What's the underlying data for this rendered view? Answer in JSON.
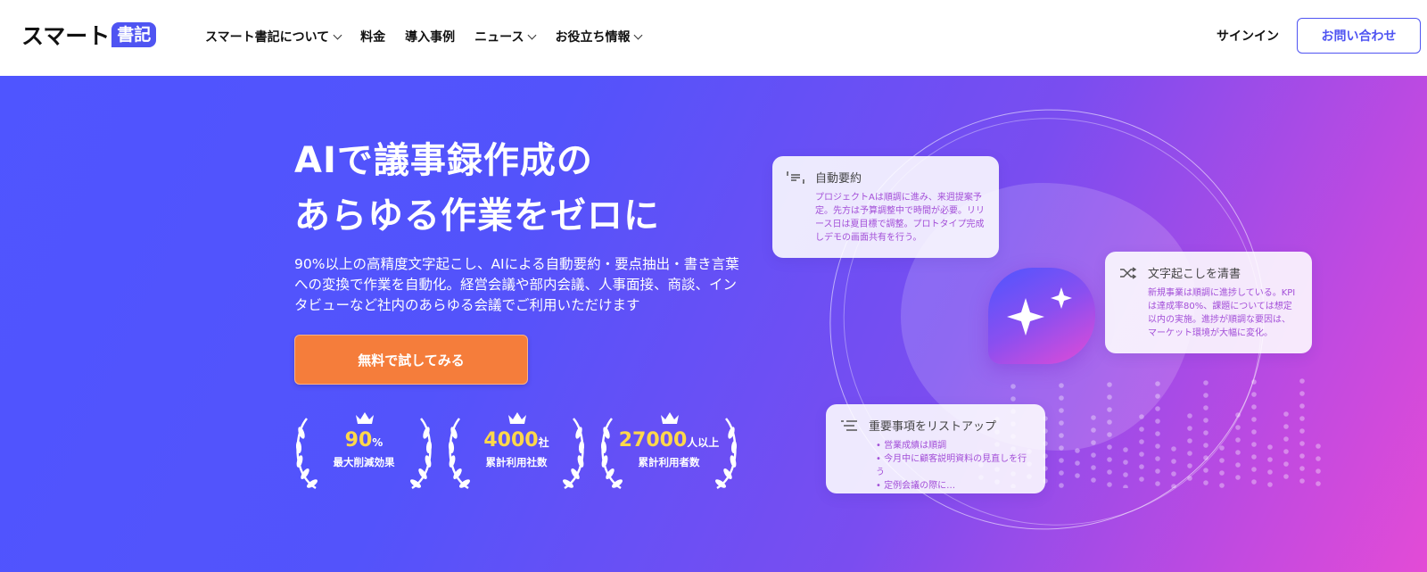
{
  "header": {
    "logo_text": "スマート",
    "logo_badge": "書記",
    "nav": [
      {
        "label": "スマート書記について",
        "has_dropdown": true
      },
      {
        "label": "料金",
        "has_dropdown": false
      },
      {
        "label": "導入事例",
        "has_dropdown": false
      },
      {
        "label": "ニュース",
        "has_dropdown": true
      },
      {
        "label": "お役立ち情報",
        "has_dropdown": true
      }
    ],
    "signin": "サインイン",
    "contact": "お問い合わせ"
  },
  "hero": {
    "title_line1": "AIで議事録作成の",
    "title_line2": "あらゆる作業をゼロに",
    "lead": "90%以上の高精度文字起こし、AIによる自動要約・要点抽出・書き言葉への変換で作業を自動化。経営会議や部内会議、人事面接、商談、インタビューなど社内のあらゆる会議でご利用いただけます",
    "cta": "無料で試してみる",
    "awards": [
      {
        "value": "90",
        "unit": "%",
        "caption": "最大削減効果"
      },
      {
        "value": "4000",
        "unit": "社",
        "caption": "累計利用社数"
      },
      {
        "value": "27000",
        "unit": "人以上",
        "caption": "累計利用者数"
      }
    ]
  },
  "cards": {
    "summary": {
      "title": "自動要約",
      "icon": "summary-icon",
      "body": "プロジェクトAは順調に進み、来週提案予定。先方は予算調整中で時間が必要。リリース日は夏目標で調整。プロトタイプ完成しデモの画面共有を行う。"
    },
    "cleanup": {
      "title": "文字起こしを清書",
      "icon": "shuffle-icon",
      "body": "新規事業は順調に進捗している。KPIは達成率80%、課題については想定以内の実施。進捗が順調な要因は、マーケット環境が大幅に変化。"
    },
    "keypoints": {
      "title": "重要事項をリストアップ",
      "icon": "list-icon",
      "items": [
        "営業成績は順調",
        "今月中に顧客説明資料の見直しを行う",
        "定例会議の際に…"
      ]
    }
  },
  "colors": {
    "brand": "#4f54f2",
    "cta": "#f57d3b",
    "award_number": "#ffd84a",
    "card_text": "#a34fd8"
  }
}
